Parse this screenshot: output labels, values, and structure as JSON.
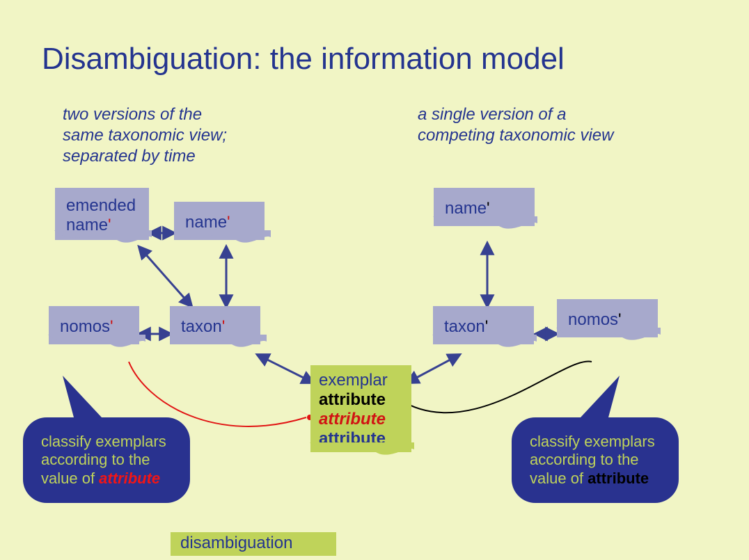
{
  "title": "Disambiguation: the information model",
  "subheads": {
    "left": "two versions of the\nsame taxonomic view;\nseparated by time",
    "right": "a single version of a\ncompeting taxonomic view"
  },
  "boxes": {
    "emended_name": "emended\nname",
    "name_left": "name",
    "nomos_left": "nomos",
    "taxon_left": "taxon",
    "name_right": "name",
    "taxon_right": "taxon",
    "nomos_right": "nomos"
  },
  "exemplar": {
    "title": "exemplar",
    "attr1": "attribute",
    "attr2": "attribute",
    "attr3": "attribute"
  },
  "callouts": {
    "left": {
      "text": "classify exemplars according to the value of ",
      "attr": "attribute"
    },
    "right": {
      "text": "classify exemplars according to the value of ",
      "attr": "attribute"
    }
  },
  "badge": "disambiguation",
  "colors": {
    "bg": "#f1f5c5",
    "boxFill": "#a7a9cc",
    "accentGreen": "#bfd35a",
    "ink": "#24348f",
    "calloutFill": "#29328f",
    "curveRed": "#e11313"
  }
}
